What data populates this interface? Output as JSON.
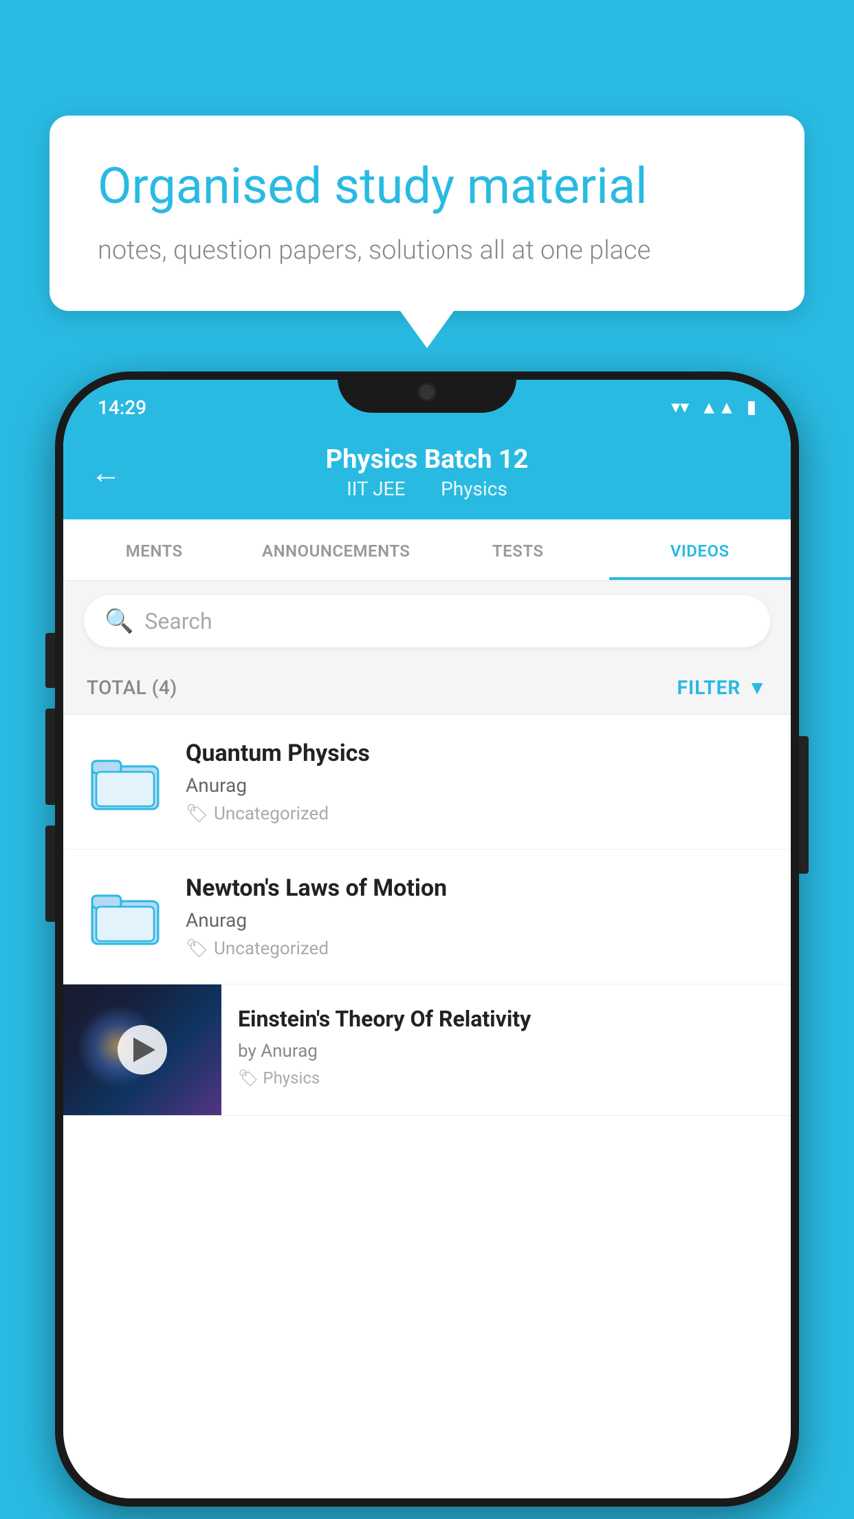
{
  "page": {
    "background_color": "#29BAE2"
  },
  "speech_bubble": {
    "title": "Organised study material",
    "subtitle": "notes, question papers, solutions all at one place"
  },
  "status_bar": {
    "time": "14:29",
    "wifi": "▾",
    "signal": "▲",
    "battery": "▮"
  },
  "top_bar": {
    "title": "Physics Batch 12",
    "subtitle_part1": "IIT JEE",
    "subtitle_part2": "Physics",
    "back_label": "←"
  },
  "tabs": [
    {
      "label": "MENTS",
      "active": false
    },
    {
      "label": "ANNOUNCEMENTS",
      "active": false
    },
    {
      "label": "TESTS",
      "active": false
    },
    {
      "label": "VIDEOS",
      "active": true
    }
  ],
  "search": {
    "placeholder": "Search"
  },
  "filter_bar": {
    "total_label": "TOTAL (4)",
    "filter_label": "FILTER"
  },
  "videos": [
    {
      "id": "quantum",
      "title": "Quantum Physics",
      "author": "Anurag",
      "tag": "Uncategorized",
      "type": "folder",
      "has_thumb": false
    },
    {
      "id": "newton",
      "title": "Newton's Laws of Motion",
      "author": "Anurag",
      "tag": "Uncategorized",
      "type": "folder",
      "has_thumb": false
    },
    {
      "id": "einstein",
      "title": "Einstein's Theory Of Relativity",
      "author": "by Anurag",
      "tag": "Physics",
      "type": "video",
      "has_thumb": true
    }
  ]
}
